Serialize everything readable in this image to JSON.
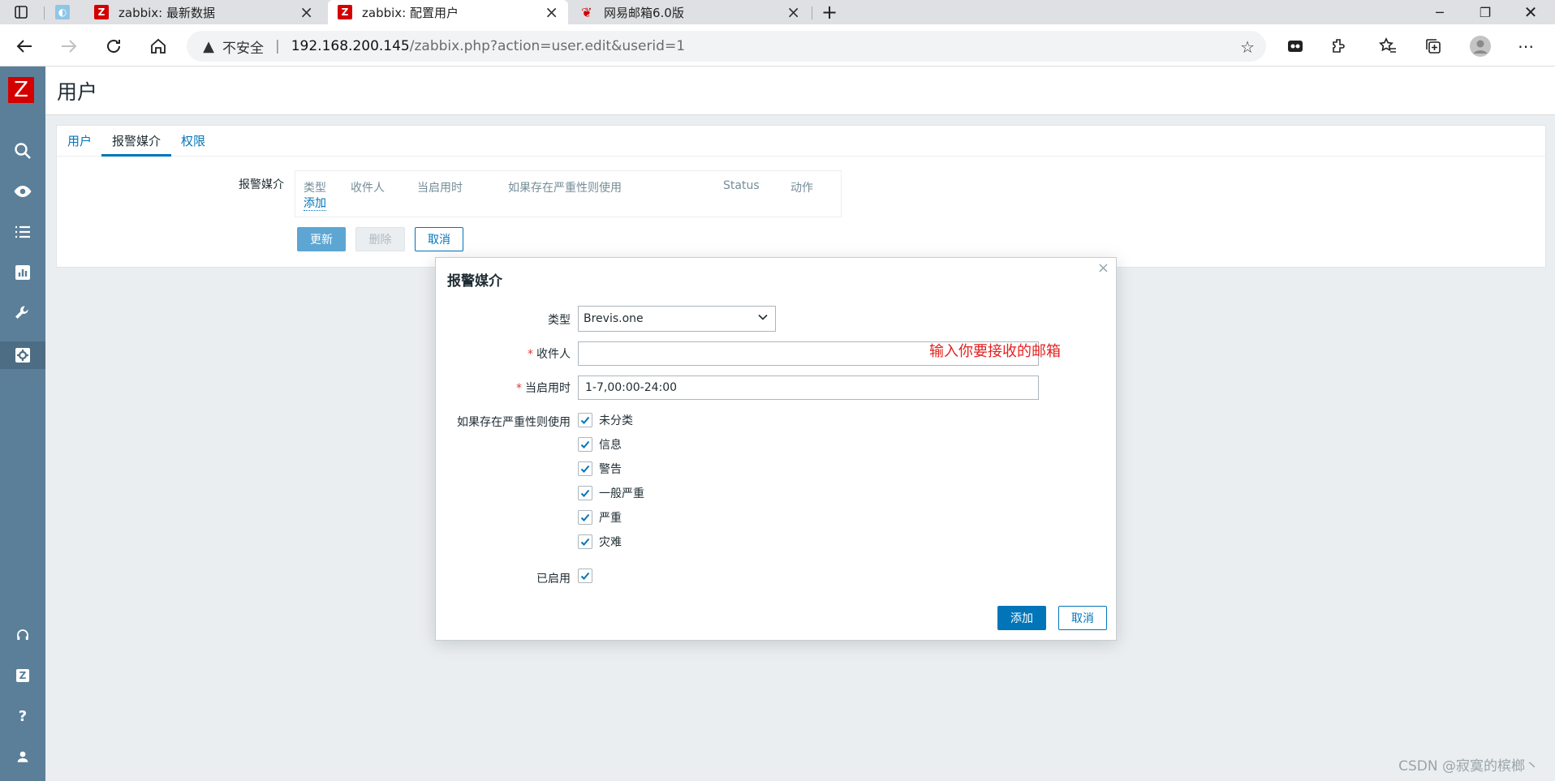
{
  "browser": {
    "tabs": [
      {
        "title": "zabbix: 最新数据"
      },
      {
        "title": "zabbix: 配置用户"
      },
      {
        "title": "网易邮箱6.0版"
      }
    ],
    "new_tab": "+",
    "insecure_label": "不安全",
    "url_host": "192.168.200.145",
    "url_rest": "/zabbix.php?action=user.edit&userid=1"
  },
  "sidebar": {
    "logo": "Z",
    "support_letter": "Z",
    "help": "?"
  },
  "page": {
    "title": "用户",
    "tabs": [
      "用户",
      "报警媒介",
      "权限"
    ],
    "media_label": "报警媒介",
    "media_columns": [
      "类型",
      "收件人",
      "当启用时",
      "如果存在严重性则使用",
      "Status",
      "动作"
    ],
    "add_link": "添加",
    "buttons": {
      "update": "更新",
      "delete": "删除",
      "cancel": "取消"
    }
  },
  "modal": {
    "title": "报警媒介",
    "close": "×",
    "type_label": "类型",
    "type_value": "Brevis.one",
    "recipient_label": "收件人",
    "recipient_value": "",
    "recipient_annotation": "输入你要接收的邮箱",
    "when_active_label": "当启用时",
    "when_active_value": "1-7,00:00-24:00",
    "severity_label": "如果存在严重性则使用",
    "severities": [
      {
        "label": "未分类",
        "checked": true
      },
      {
        "label": "信息",
        "checked": true
      },
      {
        "label": "警告",
        "checked": true
      },
      {
        "label": "一般严重",
        "checked": true
      },
      {
        "label": "严重",
        "checked": true
      },
      {
        "label": "灾难",
        "checked": true
      }
    ],
    "enabled_label": "已启用",
    "enabled_checked": true,
    "add_button": "添加",
    "cancel_button": "取消"
  },
  "watermark": "CSDN @寂寞的槟榔丶",
  "colors": {
    "accent": "#0275b8",
    "sidebar": "#5b7f99",
    "required": "#e33734",
    "annotation": "#e62020"
  }
}
